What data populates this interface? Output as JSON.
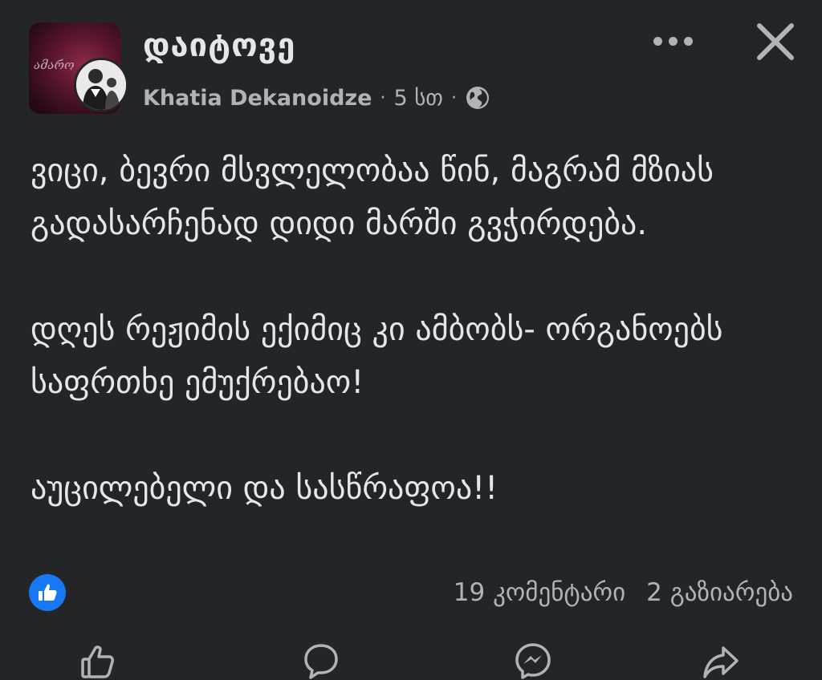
{
  "header": {
    "group_name": "დაიტოვე",
    "avatar_text": "ამარო",
    "author": "Khatia Dekanoidze",
    "separator": "·",
    "time": "5 სთ",
    "audience_icon": "globe-icon",
    "more_icon": "more-horizontal-icon",
    "close_icon": "close-icon"
  },
  "post": {
    "paragraphs": [
      "ვიცი, ბევრი მსვლელობაა წინ, მაგრამ მზიას გადასარჩენად დიდი მარში გვჭირდება.",
      "დღეს რეჟიმის ექიმიც კი ამბობს- ორგანოებს საფრთხე ემუქრებაო!",
      "აუცილებელი და სასწრაფოა!!"
    ]
  },
  "stats": {
    "reaction_icon": "like-icon",
    "comments": "19 კომენტარი",
    "shares": "2 გაზიარება"
  },
  "actions": [
    {
      "icon": "like-icon"
    },
    {
      "icon": "comment-icon"
    },
    {
      "icon": "messenger-icon"
    },
    {
      "icon": "share-icon"
    }
  ],
  "colors": {
    "background": "#242526",
    "text_primary": "#e4e6eb",
    "text_secondary": "#b0b3b8",
    "accent": "#1877f2"
  }
}
